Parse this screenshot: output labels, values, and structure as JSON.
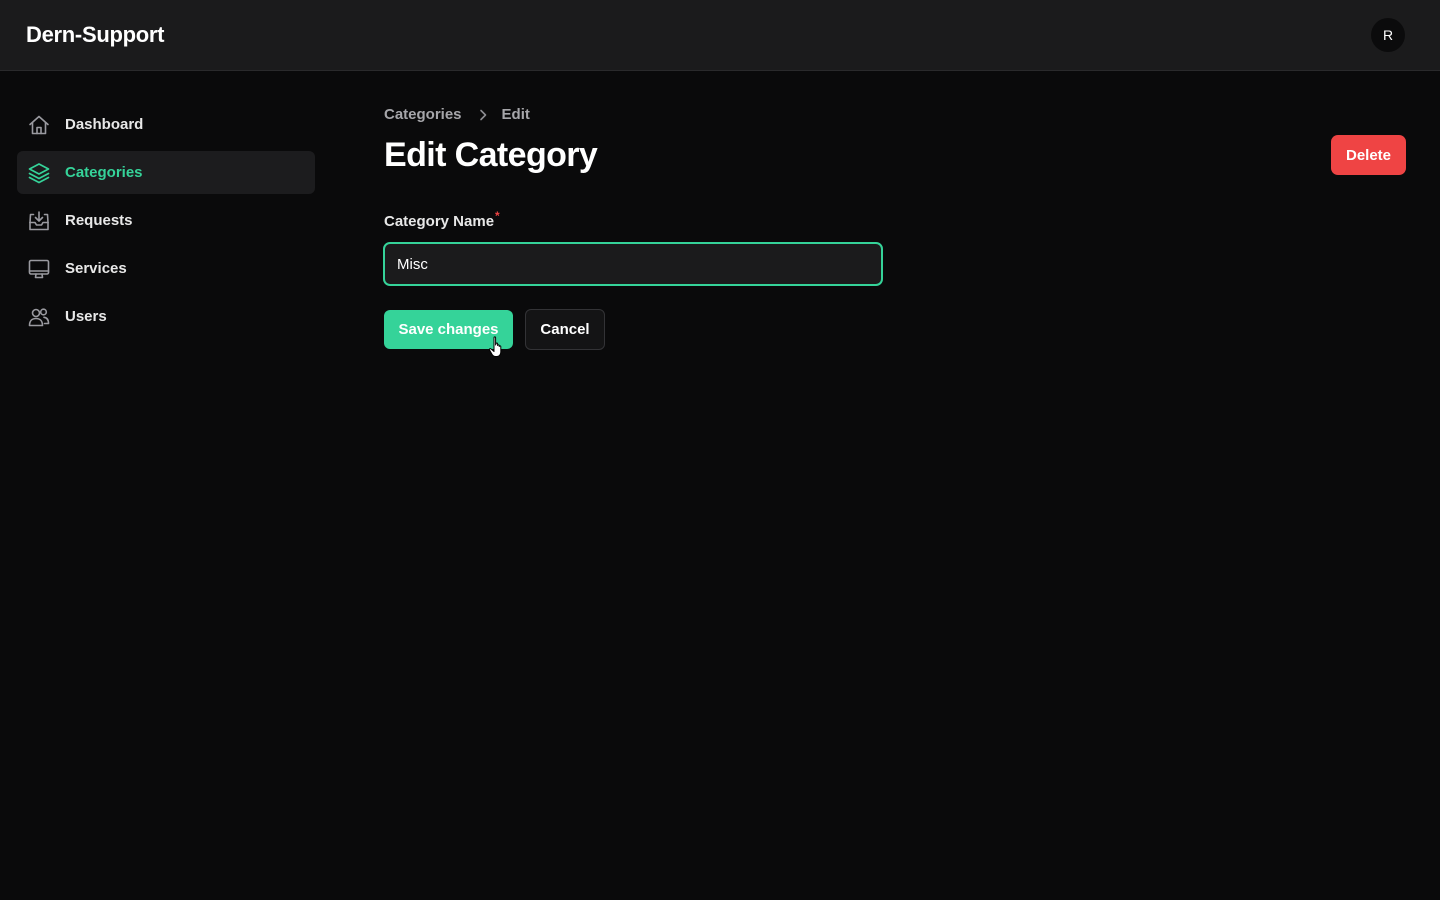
{
  "app": {
    "brand": "Dern-Support",
    "avatar_initial": "R"
  },
  "sidebar": {
    "items": [
      {
        "label": "Dashboard",
        "icon": "home-icon",
        "active": false
      },
      {
        "label": "Categories",
        "icon": "layers-icon",
        "active": true
      },
      {
        "label": "Requests",
        "icon": "inbox-tray-icon",
        "active": false
      },
      {
        "label": "Services",
        "icon": "monitor-icon",
        "active": false
      },
      {
        "label": "Users",
        "icon": "users-icon",
        "active": false
      }
    ]
  },
  "breadcrumb": {
    "items": [
      "Categories",
      "Edit"
    ]
  },
  "page": {
    "title": "Edit Category",
    "delete_label": "Delete"
  },
  "form": {
    "category_name": {
      "label": "Category Name",
      "required_mark": "*",
      "value": "Misc"
    },
    "save_label": "Save changes",
    "cancel_label": "Cancel"
  },
  "colors": {
    "accent": "#35d399",
    "danger": "#ef4444",
    "background": "#0a0a0b",
    "topbar": "#1b1b1c"
  }
}
